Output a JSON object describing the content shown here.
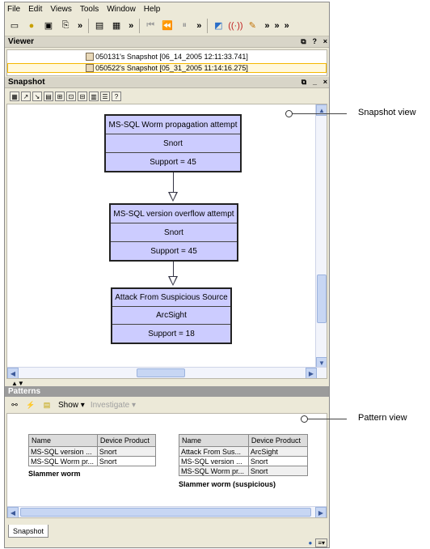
{
  "menu": [
    "File",
    "Edit",
    "Views",
    "Tools",
    "Window",
    "Help"
  ],
  "toolbar": {
    "more": "»"
  },
  "viewer": {
    "title": "Viewer",
    "controls": [
      "⧉",
      "?",
      "×"
    ],
    "snapshots": [
      "050131's Snapshot [06_14_2005 12:11:33.741]",
      "050522's Snapshot [05_31_2005 11:14:16.275]"
    ]
  },
  "snapshot_pane": {
    "title": "Snapshot",
    "controls": [
      "⧉",
      "_",
      "×"
    ],
    "nodes": [
      {
        "name": "MS-SQL Worm propagation attempt",
        "product": "Snort",
        "support": "Support = 45"
      },
      {
        "name": "MS-SQL version overflow attempt",
        "product": "Snort",
        "support": "Support = 45"
      },
      {
        "name": "Attack From Suspicious Source",
        "product": "ArcSight",
        "support": "Support = 18"
      }
    ]
  },
  "patterns": {
    "title": "Patterns",
    "show_label": "Show ▾",
    "investigate_label": "Investigate ▾",
    "tables": [
      {
        "headers": [
          "Name",
          "Device Product"
        ],
        "rows": [
          [
            "MS-SQL version ...",
            "Snort"
          ],
          [
            "MS-SQL Worm pr...",
            "Snort"
          ]
        ],
        "caption": "Slammer worm"
      },
      {
        "headers": [
          "Name",
          "Device Product"
        ],
        "rows": [
          [
            "Attack From Sus...",
            "ArcSight"
          ],
          [
            "MS-SQL version ...",
            "Snort"
          ],
          [
            "MS-SQL Worm pr...",
            "Snort"
          ]
        ],
        "caption": "Slammer worm (suspicious)"
      }
    ]
  },
  "bottom_tab": "Snapshot",
  "callouts": {
    "snapshot": "Snapshot view",
    "pattern": "Pattern view"
  },
  "colors": {
    "node_fill": "#ccccff",
    "patterns_header": "#9b9b9b",
    "selected_border": "#f5b800"
  }
}
